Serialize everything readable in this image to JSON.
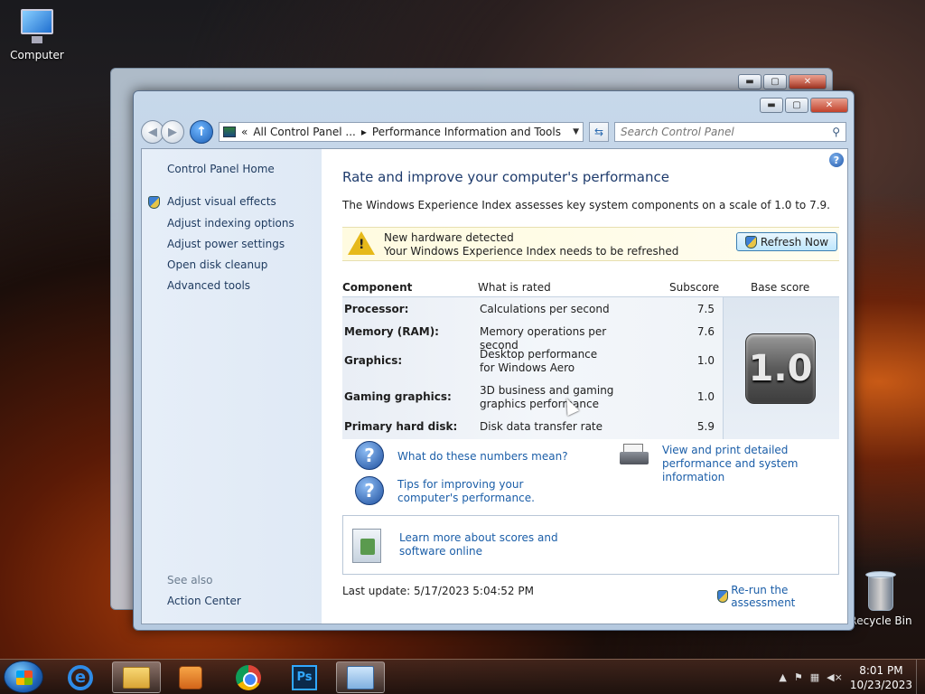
{
  "desktop": {
    "computer_label": "Computer",
    "recycle_label": "Recycle Bin"
  },
  "window": {
    "controls": {
      "minimize": "▬",
      "maximize": "▢",
      "close": "✕"
    },
    "address": {
      "prefix": "«",
      "crumb1": "All Control Panel ...",
      "sep": "▸",
      "crumb2": "Performance Information and Tools"
    },
    "search_placeholder": "Search Control Panel"
  },
  "sidebar": {
    "home": "Control Panel Home",
    "items": [
      "Adjust visual effects",
      "Adjust indexing options",
      "Adjust power settings",
      "Open disk cleanup",
      "Advanced tools"
    ],
    "see_also": "See also",
    "action_center": "Action Center"
  },
  "main": {
    "title": "Rate and improve your computer's performance",
    "description": "The Windows Experience Index assesses key system components on a scale of 1.0 to 7.9.",
    "notice": {
      "line1": "New hardware detected",
      "line2": "Your Windows Experience Index needs to be refreshed",
      "button": "Refresh Now"
    },
    "table": {
      "headers": [
        "Component",
        "What is rated",
        "Subscore",
        "Base score"
      ],
      "rows": [
        {
          "component": "Processor:",
          "rated": "Calculations per second",
          "subscore": "7.5"
        },
        {
          "component": "Memory (RAM):",
          "rated": "Memory operations per second",
          "subscore": "7.6"
        },
        {
          "component": "Graphics:",
          "rated": "Desktop performance for Windows Aero",
          "subscore": "1.0"
        },
        {
          "component": "Gaming graphics:",
          "rated": "3D business and gaming graphics performance",
          "subscore": "1.0"
        },
        {
          "component": "Primary hard disk:",
          "rated": "Disk data transfer rate",
          "subscore": "5.9"
        }
      ],
      "base_score": "1.0"
    },
    "links": {
      "numbers": "What do these numbers mean?",
      "tips": "Tips for improving your computer's performance.",
      "print": "View and print detailed performance and system information",
      "learn": "Learn more about scores and software online"
    },
    "last_update": "Last update: 5/17/2023 5:04:52 PM",
    "rerun": "Re-run the assessment"
  },
  "taskbar": {
    "photoshop_label": "Ps",
    "clock_time": "8:01 PM",
    "clock_date": "10/23/2023"
  },
  "colors": {
    "link": "#1b5ea8",
    "title": "#1e3b6c",
    "notice_bg": "#fffbe0"
  },
  "icons": [
    "computer-icon",
    "recycle-bin-icon",
    "back-icon",
    "forward-icon",
    "up-icon",
    "refresh-icon",
    "search-icon",
    "help-icon",
    "shield-icon",
    "warning-icon",
    "question-icon",
    "printer-icon",
    "learn-more-icon",
    "start-orb-icon",
    "ie-icon",
    "explorer-icon",
    "media-icon",
    "chrome-icon",
    "photoshop-icon",
    "control-panel-icon"
  ]
}
